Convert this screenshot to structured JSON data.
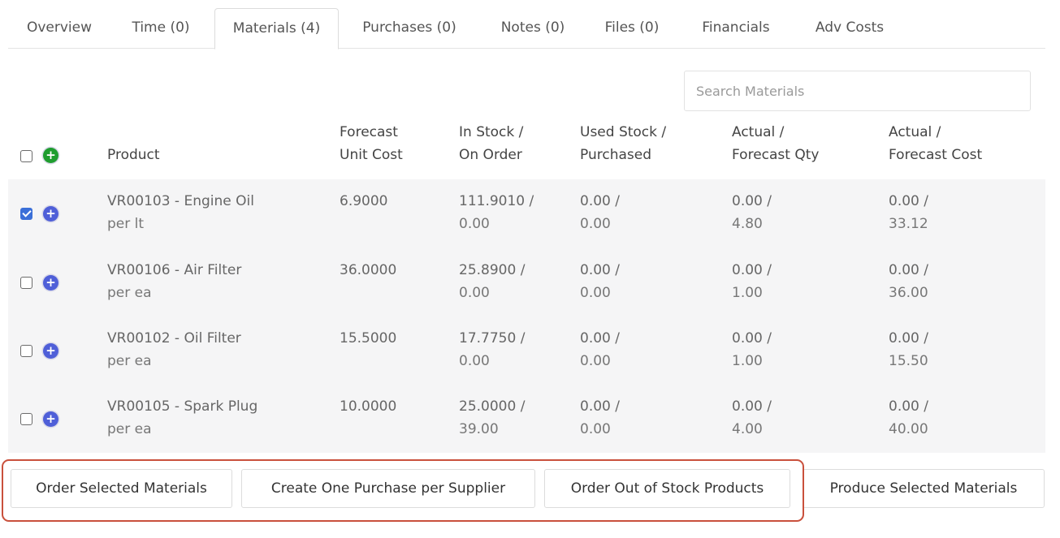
{
  "tabs": [
    {
      "label": "Overview"
    },
    {
      "label": "Time (0)"
    },
    {
      "label": "Materials (4)"
    },
    {
      "label": "Purchases (0)"
    },
    {
      "label": "Notes (0)"
    },
    {
      "label": "Files (0)"
    },
    {
      "label": "Financials"
    },
    {
      "label": "Adv Costs"
    }
  ],
  "active_tab": "Materials (4)",
  "search": {
    "placeholder": "Search Materials",
    "value": ""
  },
  "columns": {
    "product": "Product",
    "forecast_unit_cost": [
      "Forecast",
      "Unit Cost"
    ],
    "stock": [
      "In Stock /",
      "On Order"
    ],
    "used": [
      "Used Stock /",
      "Purchased"
    ],
    "qty": [
      "Actual /",
      "Forecast Qty"
    ],
    "cost": [
      "Actual /",
      "Forecast Cost"
    ]
  },
  "rows": [
    {
      "checked": true,
      "product": "VR00103 - Engine Oil",
      "unit": "per lt",
      "forecast_unit_cost": "6.9000",
      "in_stock": "111.9010 /",
      "on_order": "0.00",
      "used": "0.00 /",
      "purchased": "0.00",
      "actual_qty": "0.00 /",
      "forecast_qty": "4.80",
      "actual_cost": "0.00 /",
      "forecast_cost": "33.12"
    },
    {
      "checked": false,
      "product": "VR00106 - Air Filter",
      "unit": "per ea",
      "forecast_unit_cost": "36.0000",
      "in_stock": "25.8900 /",
      "on_order": "0.00",
      "used": "0.00 /",
      "purchased": "0.00",
      "actual_qty": "0.00 /",
      "forecast_qty": "1.00",
      "actual_cost": "0.00 /",
      "forecast_cost": "36.00"
    },
    {
      "checked": false,
      "product": "VR00102 - Oil Filter",
      "unit": "per ea",
      "forecast_unit_cost": "15.5000",
      "in_stock": "17.7750 /",
      "on_order": "0.00",
      "used": "0.00 /",
      "purchased": "0.00",
      "actual_qty": "0.00 /",
      "forecast_qty": "1.00",
      "actual_cost": "0.00 /",
      "forecast_cost": "15.50"
    },
    {
      "checked": false,
      "product": "VR00105 - Spark Plug",
      "unit": "per ea",
      "forecast_unit_cost": "10.0000",
      "in_stock": "25.0000 /",
      "on_order": "39.00",
      "used": "0.00 /",
      "purchased": "0.00",
      "actual_qty": "0.00 /",
      "forecast_qty": "4.00",
      "actual_cost": "0.00 /",
      "forecast_cost": "40.00"
    }
  ],
  "buttons": {
    "order_selected": "Order Selected Materials",
    "one_purchase": "Create One Purchase per Supplier",
    "order_out_of_stock": "Order Out of Stock Products",
    "produce_selected": "Produce Selected Materials"
  },
  "colors": {
    "add_header": "#1f9d2f",
    "add_row": "#4f5fd8",
    "checkbox_checked": "#3b6fd8",
    "highlight": "#c9503c",
    "row_bg": "#f5f5f6"
  },
  "icons": {
    "header_add": "plus-circle-icon",
    "row_add": "plus-circle-icon"
  }
}
